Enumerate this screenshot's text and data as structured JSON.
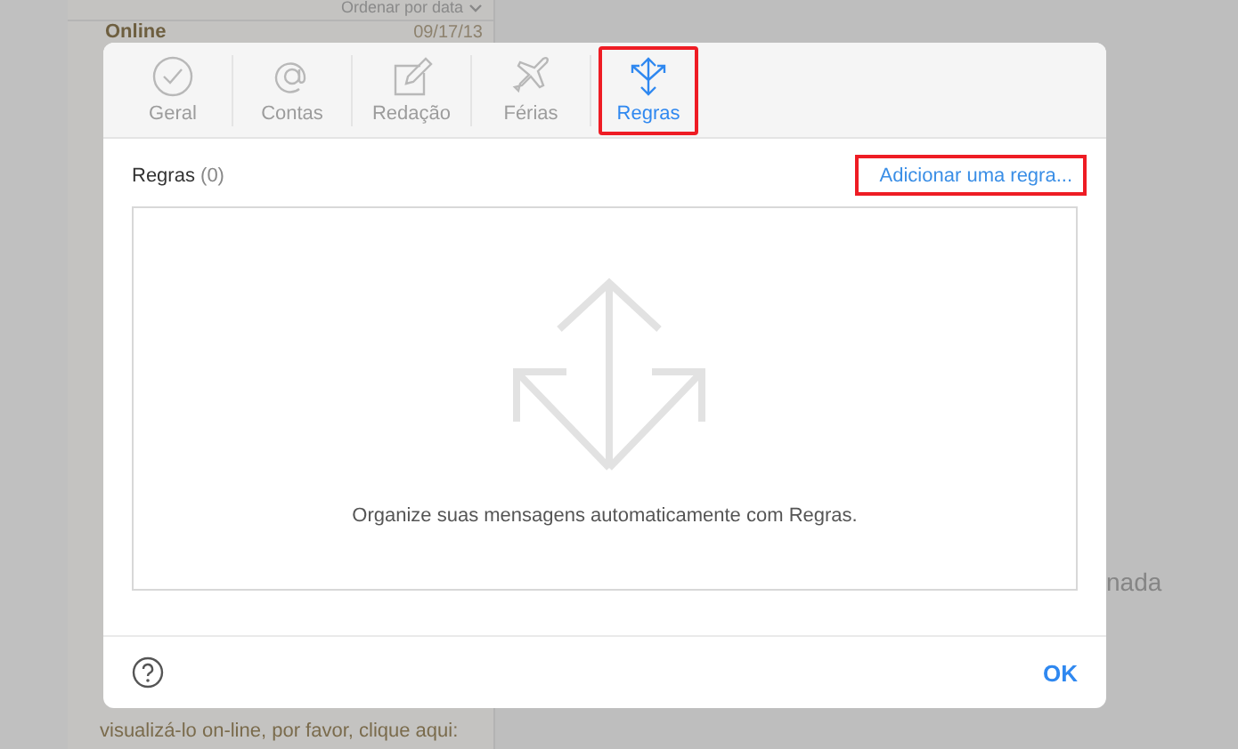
{
  "background": {
    "sort_label": "Ordenar por data",
    "message": {
      "sender": "Online",
      "date": "09/17/13"
    },
    "preview_text": "visualizá-lo on-line, por favor, clique aqui:",
    "empty_text": "nada"
  },
  "dialog": {
    "tabs": [
      {
        "label": "Geral",
        "kind": "check",
        "selected": false,
        "annotated": false
      },
      {
        "label": "Contas",
        "kind": "at",
        "selected": false,
        "annotated": false
      },
      {
        "label": "Redação",
        "kind": "compose",
        "selected": false,
        "annotated": false
      },
      {
        "label": "Férias",
        "kind": "plane",
        "selected": false,
        "annotated": false
      },
      {
        "label": "Regras",
        "kind": "rules",
        "selected": true,
        "annotated": true
      }
    ],
    "section_title": "Regras",
    "rule_count": "(0)",
    "add_link": {
      "label": "Adicionar uma regra...",
      "annotated": true
    },
    "empty_message": "Organize suas mensagens automaticamente com Regras.",
    "ok_button": "OK"
  }
}
